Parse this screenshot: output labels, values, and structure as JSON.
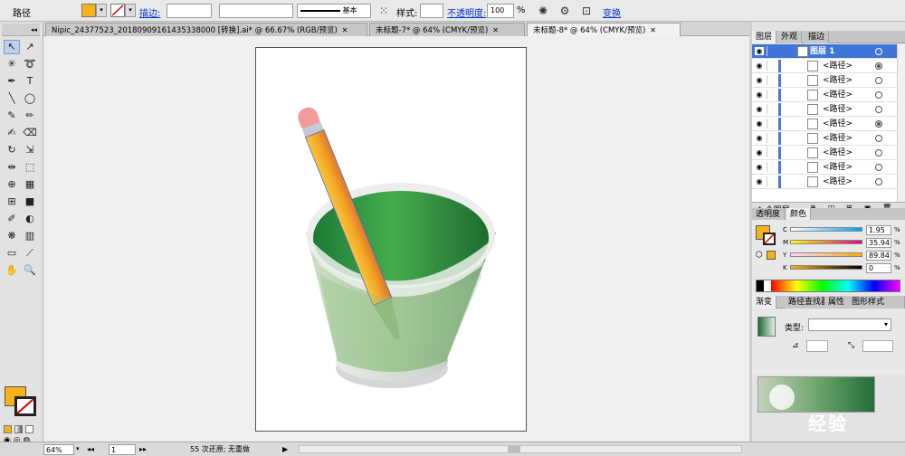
{
  "control_bar": {
    "object_type": "路径",
    "fill_color": "#f7b21a",
    "stroke_label": "描边:",
    "stroke_weight": "",
    "stroke_profile_label": "基本",
    "style_label": "样式:",
    "opacity_label": "不透明度:",
    "opacity_value": "100",
    "opacity_unit": "%",
    "transform_label": "变换"
  },
  "tabs": [
    {
      "label": "Nipic_24377523_20180909161435338000 [转换].ai* @ 66.67% (RGB/预览)",
      "close": "✕"
    },
    {
      "label": "未标题-7* @ 64% (CMYK/预览)",
      "close": "✕"
    },
    {
      "label": "未标题-8* @ 64% (CMYK/预览)",
      "close": "✕"
    }
  ],
  "toolbox": {
    "fill_color": "#f7b21a",
    "tools": [
      {
        "icon": "selection-tool-icon",
        "glyph": "↖",
        "active": true
      },
      {
        "icon": "direct-selection-tool-icon",
        "glyph": "↗"
      },
      {
        "icon": "magic-wand-tool-icon",
        "glyph": "✳"
      },
      {
        "icon": "lasso-tool-icon",
        "glyph": "➰"
      },
      {
        "icon": "pen-tool-icon",
        "glyph": "✒"
      },
      {
        "icon": "type-tool-icon",
        "glyph": "T"
      },
      {
        "icon": "line-tool-icon",
        "glyph": "╲"
      },
      {
        "icon": "ellipse-tool-icon",
        "glyph": "◯"
      },
      {
        "icon": "paintbrush-tool-icon",
        "glyph": "✎"
      },
      {
        "icon": "pencil-tool-icon",
        "glyph": "✏"
      },
      {
        "icon": "blob-brush-tool-icon",
        "glyph": "✍"
      },
      {
        "icon": "eraser-tool-icon",
        "glyph": "⌫"
      },
      {
        "icon": "rotate-tool-icon",
        "glyph": "↻"
      },
      {
        "icon": "scale-tool-icon",
        "glyph": "⇲"
      },
      {
        "icon": "width-tool-icon",
        "glyph": "⇹"
      },
      {
        "icon": "free-transform-tool-icon",
        "glyph": "⬚"
      },
      {
        "icon": "shape-builder-tool-icon",
        "glyph": "⊕"
      },
      {
        "icon": "perspective-grid-tool-icon",
        "glyph": "▦"
      },
      {
        "icon": "mesh-tool-icon",
        "glyph": "⊞"
      },
      {
        "icon": "gradient-tool-icon",
        "glyph": "■"
      },
      {
        "icon": "eyedropper-tool-icon",
        "glyph": "✐"
      },
      {
        "icon": "blend-tool-icon",
        "glyph": "◐"
      },
      {
        "icon": "symbol-sprayer-tool-icon",
        "glyph": "❋"
      },
      {
        "icon": "column-graph-tool-icon",
        "glyph": "▥"
      },
      {
        "icon": "artboard-tool-icon",
        "glyph": "▭"
      },
      {
        "icon": "slice-tool-icon",
        "glyph": "⟋"
      },
      {
        "icon": "hand-tool-icon",
        "glyph": "✋"
      },
      {
        "icon": "zoom-tool-icon",
        "glyph": "🔍"
      }
    ]
  },
  "layers_panel": {
    "tabs": [
      "图层",
      "外观",
      "描边"
    ],
    "top_layer": "图层 1",
    "items": [
      {
        "name": "<路径>",
        "targeted": true
      },
      {
        "name": "<路径>",
        "targeted": false
      },
      {
        "name": "<路径>",
        "targeted": false
      },
      {
        "name": "<路径>",
        "targeted": false
      },
      {
        "name": "<路径>",
        "targeted": true
      },
      {
        "name": "<路径>",
        "targeted": false
      },
      {
        "name": "<路径>",
        "targeted": false
      },
      {
        "name": "<路径>",
        "targeted": false
      },
      {
        "name": "<路径>",
        "targeted": false
      }
    ],
    "footer_count": "1 个图层"
  },
  "color_panel": {
    "tabs": [
      "透明度",
      "颜色"
    ],
    "channels": [
      {
        "label": "C",
        "value": "1.95",
        "color_from": "#ffffff",
        "color_to": "#00a0e9"
      },
      {
        "label": "M",
        "value": "35.94",
        "color_from": "#ffff00",
        "color_to": "#e4007f"
      },
      {
        "label": "Y",
        "value": "89.84",
        "color_from": "#fbd7ff",
        "color_to": "#ffaa00"
      },
      {
        "label": "K",
        "value": "0",
        "color_from": "#f7b21a",
        "color_to": "#000000"
      }
    ],
    "unit": "%"
  },
  "gradient_panel": {
    "tabs": [
      "渐变",
      "路径查找器",
      "属性",
      "图形样式"
    ],
    "type_label": "类型:",
    "type_value": ""
  },
  "status_bar": {
    "zoom": "64%",
    "artboard": "1",
    "undo_text": "55 次还原; 无重做"
  },
  "watermark": {
    "text": "经验"
  }
}
